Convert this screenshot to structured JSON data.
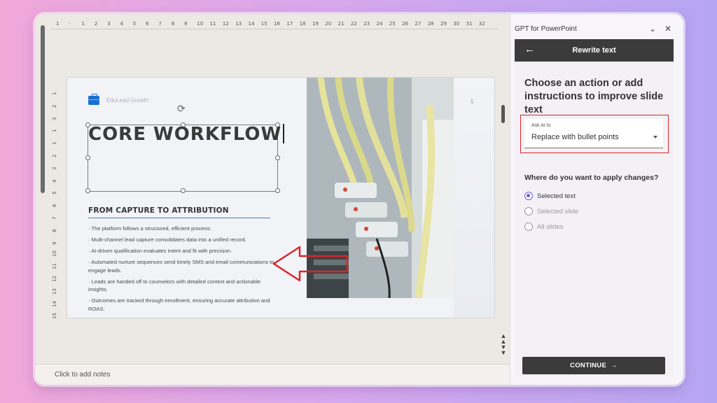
{
  "ruler": {
    "marks": [
      "1",
      "·",
      "1",
      "2",
      "3",
      "4",
      "5",
      "6",
      "7",
      "8",
      "9",
      "10",
      "11",
      "12",
      "13",
      "14",
      "15",
      "16",
      "17",
      "18",
      "19",
      "20",
      "21",
      "22",
      "23",
      "24",
      "25",
      "26",
      "27",
      "28",
      "29",
      "30",
      "31",
      "32"
    ],
    "vmarks": [
      "1",
      "2",
      "3",
      "1",
      "1",
      "2",
      "3",
      "4",
      "5",
      "6",
      "7",
      "8",
      "9",
      "10",
      "11",
      "12",
      "13",
      "14",
      "15"
    ]
  },
  "slide": {
    "brand": "EduLead Growth",
    "page_number": "5",
    "title": "CORE WORKFLOW",
    "subheading": "FROM CAPTURE TO ATTRIBUTION",
    "bullets": [
      "· The platform follows a structured, efficient process:",
      "· Multi-channel lead capture consolidates data into a unified record.",
      "· AI-driven qualification evaluates intent and fit with precision.",
      "· Automated nurture sequences send timely SMS and email communications to engage leads.",
      "· Leads are handed off to counselors with detailed context and actionable insights.",
      "· Outcomes are tracked through enrollment, ensuring accurate attribution and ROAS."
    ]
  },
  "notes": {
    "placeholder": "Click to add notes"
  },
  "pane": {
    "app_title": "GPT for PowerPoint",
    "header": "Rewrite text",
    "prompt": "Choose an action or add instructions to improve slide text",
    "select_label": "Ask AI to",
    "select_value": "Replace with bullet points",
    "apply_question": "Where do you want to apply changes?",
    "options": [
      {
        "label": "Selected text",
        "checked": true
      },
      {
        "label": "Selected slide",
        "checked": false
      },
      {
        "label": "All slides",
        "checked": false
      }
    ],
    "continue_label": "CONTINUE"
  },
  "colors": {
    "accent": "#6b5fcf",
    "highlight": "#d9262b",
    "header_bg": "#3b3b3b",
    "brand": "#1a6fd1"
  },
  "icons": [
    "chevron-down-icon",
    "close-icon",
    "back-arrow-icon",
    "arrow-right-icon",
    "briefcase-icon",
    "rotate-handle-icon"
  ]
}
